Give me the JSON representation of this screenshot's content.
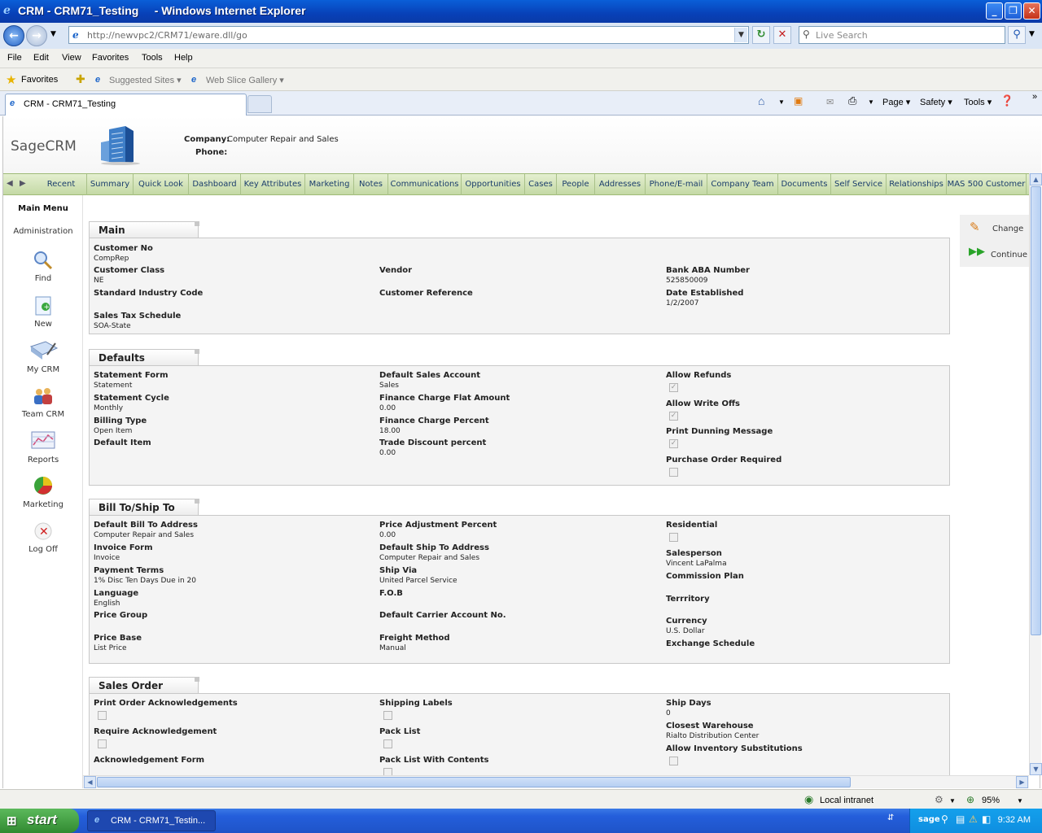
{
  "window": {
    "title": "CRM - CRM71_Testing     - Windows Internet Explorer"
  },
  "address": {
    "url": "http://newvpc2/CRM71/eware.dll/go",
    "search_placeholder": "Live Search"
  },
  "menu": [
    "File",
    "Edit",
    "View",
    "Favorites",
    "Tools",
    "Help"
  ],
  "favorites": {
    "label": "Favorites",
    "items": [
      "Suggested Sites ▾",
      "Web Slice Gallery ▾"
    ]
  },
  "browser_tab": {
    "title": "CRM - CRM71_Testing"
  },
  "command_bar": [
    "Page ▾",
    "Safety ▾",
    "Tools ▾"
  ],
  "header": {
    "logo": "SageCRM",
    "company_label": "Company:",
    "company_value": "Computer Repair and Sales",
    "phone_label": "Phone:",
    "phone_value": ""
  },
  "crm_tabs": [
    "Recent",
    "Summary",
    "Quick Look",
    "Dashboard",
    "Key Attributes",
    "Marketing",
    "Notes",
    "Communications",
    "Opportunities",
    "Cases",
    "People",
    "Addresses",
    "Phone/E-mail",
    "Company Team",
    "Documents",
    "Self Service",
    "Relationships",
    "MAS 500 Customer"
  ],
  "left_nav": {
    "main_menu": "Main Menu",
    "admin": "Administration",
    "items": [
      "Find",
      "New",
      "My CRM",
      "Team CRM",
      "Reports",
      "Marketing",
      "Log Off"
    ]
  },
  "actions": {
    "change": "Change",
    "continue": "Continue"
  },
  "sections": {
    "main": {
      "title": "Main",
      "fields": {
        "customer_no": {
          "label": "Customer No",
          "value": "CompRep"
        },
        "customer_class": {
          "label": "Customer Class",
          "value": "NE"
        },
        "vendor": {
          "label": "Vendor",
          "value": ""
        },
        "bank_aba": {
          "label": "Bank ABA Number",
          "value": "525850009"
        },
        "sic": {
          "label": "Standard Industry Code",
          "value": ""
        },
        "cust_ref": {
          "label": "Customer Reference",
          "value": ""
        },
        "date_est": {
          "label": "Date Established",
          "value": "1/2/2007"
        },
        "sales_tax": {
          "label": "Sales Tax Schedule",
          "value": "SOA-State"
        }
      }
    },
    "defaults": {
      "title": "Defaults",
      "fields": {
        "statement_form": {
          "label": "Statement Form",
          "value": "Statement"
        },
        "statement_cycle": {
          "label": "Statement Cycle",
          "value": "Monthly"
        },
        "billing_type": {
          "label": "Billing Type",
          "value": "Open Item"
        },
        "default_item": {
          "label": "Default Item",
          "value": ""
        },
        "def_sales_acct": {
          "label": "Default Sales Account",
          "value": "Sales"
        },
        "fin_flat": {
          "label": "Finance Charge Flat Amount",
          "value": "0.00"
        },
        "fin_pct": {
          "label": "Finance Charge Percent",
          "value": "18.00"
        },
        "trade_disc": {
          "label": "Trade Discount percent",
          "value": "0.00"
        },
        "allow_refunds": {
          "label": "Allow Refunds",
          "checked": true
        },
        "allow_writeoffs": {
          "label": "Allow Write Offs",
          "checked": true
        },
        "print_dunning": {
          "label": "Print Dunning Message",
          "checked": true
        },
        "po_required": {
          "label": "Purchase Order Required",
          "checked": false
        }
      }
    },
    "billto": {
      "title": "Bill To/Ship To",
      "fields": {
        "def_bill_to": {
          "label": "Default Bill To Address",
          "value": "Computer Repair and Sales"
        },
        "invoice_form": {
          "label": "Invoice Form",
          "value": "Invoice"
        },
        "payment_terms": {
          "label": "Payment Terms",
          "value": "1% Disc Ten Days Due in 20"
        },
        "language": {
          "label": "Language",
          "value": "English"
        },
        "price_group": {
          "label": "Price Group",
          "value": ""
        },
        "price_base": {
          "label": "Price Base",
          "value": "List Price"
        },
        "price_adj": {
          "label": "Price Adjustment Percent",
          "value": "0.00"
        },
        "def_ship_to": {
          "label": "Default Ship To Address",
          "value": "Computer Repair and Sales"
        },
        "ship_via": {
          "label": "Ship Via",
          "value": "United Parcel Service"
        },
        "fob": {
          "label": "F.O.B",
          "value": ""
        },
        "carrier_acct": {
          "label": "Default Carrier Account No.",
          "value": ""
        },
        "freight": {
          "label": "Freight Method",
          "value": "Manual"
        },
        "residential": {
          "label": "Residential",
          "checked": false
        },
        "salesperson": {
          "label": "Salesperson",
          "value": "Vincent LaPalma"
        },
        "commission": {
          "label": "Commission Plan",
          "value": ""
        },
        "territory": {
          "label": "Terrritory",
          "value": ""
        },
        "currency": {
          "label": "Currency",
          "value": "U.S. Dollar"
        },
        "exchange": {
          "label": "Exchange Schedule",
          "value": ""
        }
      }
    },
    "salesorder": {
      "title": "Sales Order",
      "fields": {
        "print_ack": {
          "label": "Print Order Acknowledgements",
          "checked": false
        },
        "require_ack": {
          "label": "Require Acknowledgement",
          "checked": false
        },
        "ack_form": {
          "label": "Acknowledgement Form",
          "value": ""
        },
        "ship_labels": {
          "label": "Shipping Labels",
          "checked": false
        },
        "pack_list": {
          "label": "Pack List",
          "checked": false
        },
        "pack_list_contents": {
          "label": "Pack List With Contents",
          "checked": false
        },
        "ship_days": {
          "label": "Ship Days",
          "value": "0"
        },
        "closest_wh": {
          "label": "Closest Warehouse",
          "value": "Rialto Distribution Center"
        },
        "allow_inv_sub": {
          "label": "Allow Inventory Substitutions",
          "checked": false
        }
      }
    }
  },
  "statusbar": {
    "zone": "Local intranet",
    "zoom": "95%"
  },
  "taskbar": {
    "start": "start",
    "item": "CRM - CRM71_Testin...",
    "clock": "9:32 AM"
  }
}
